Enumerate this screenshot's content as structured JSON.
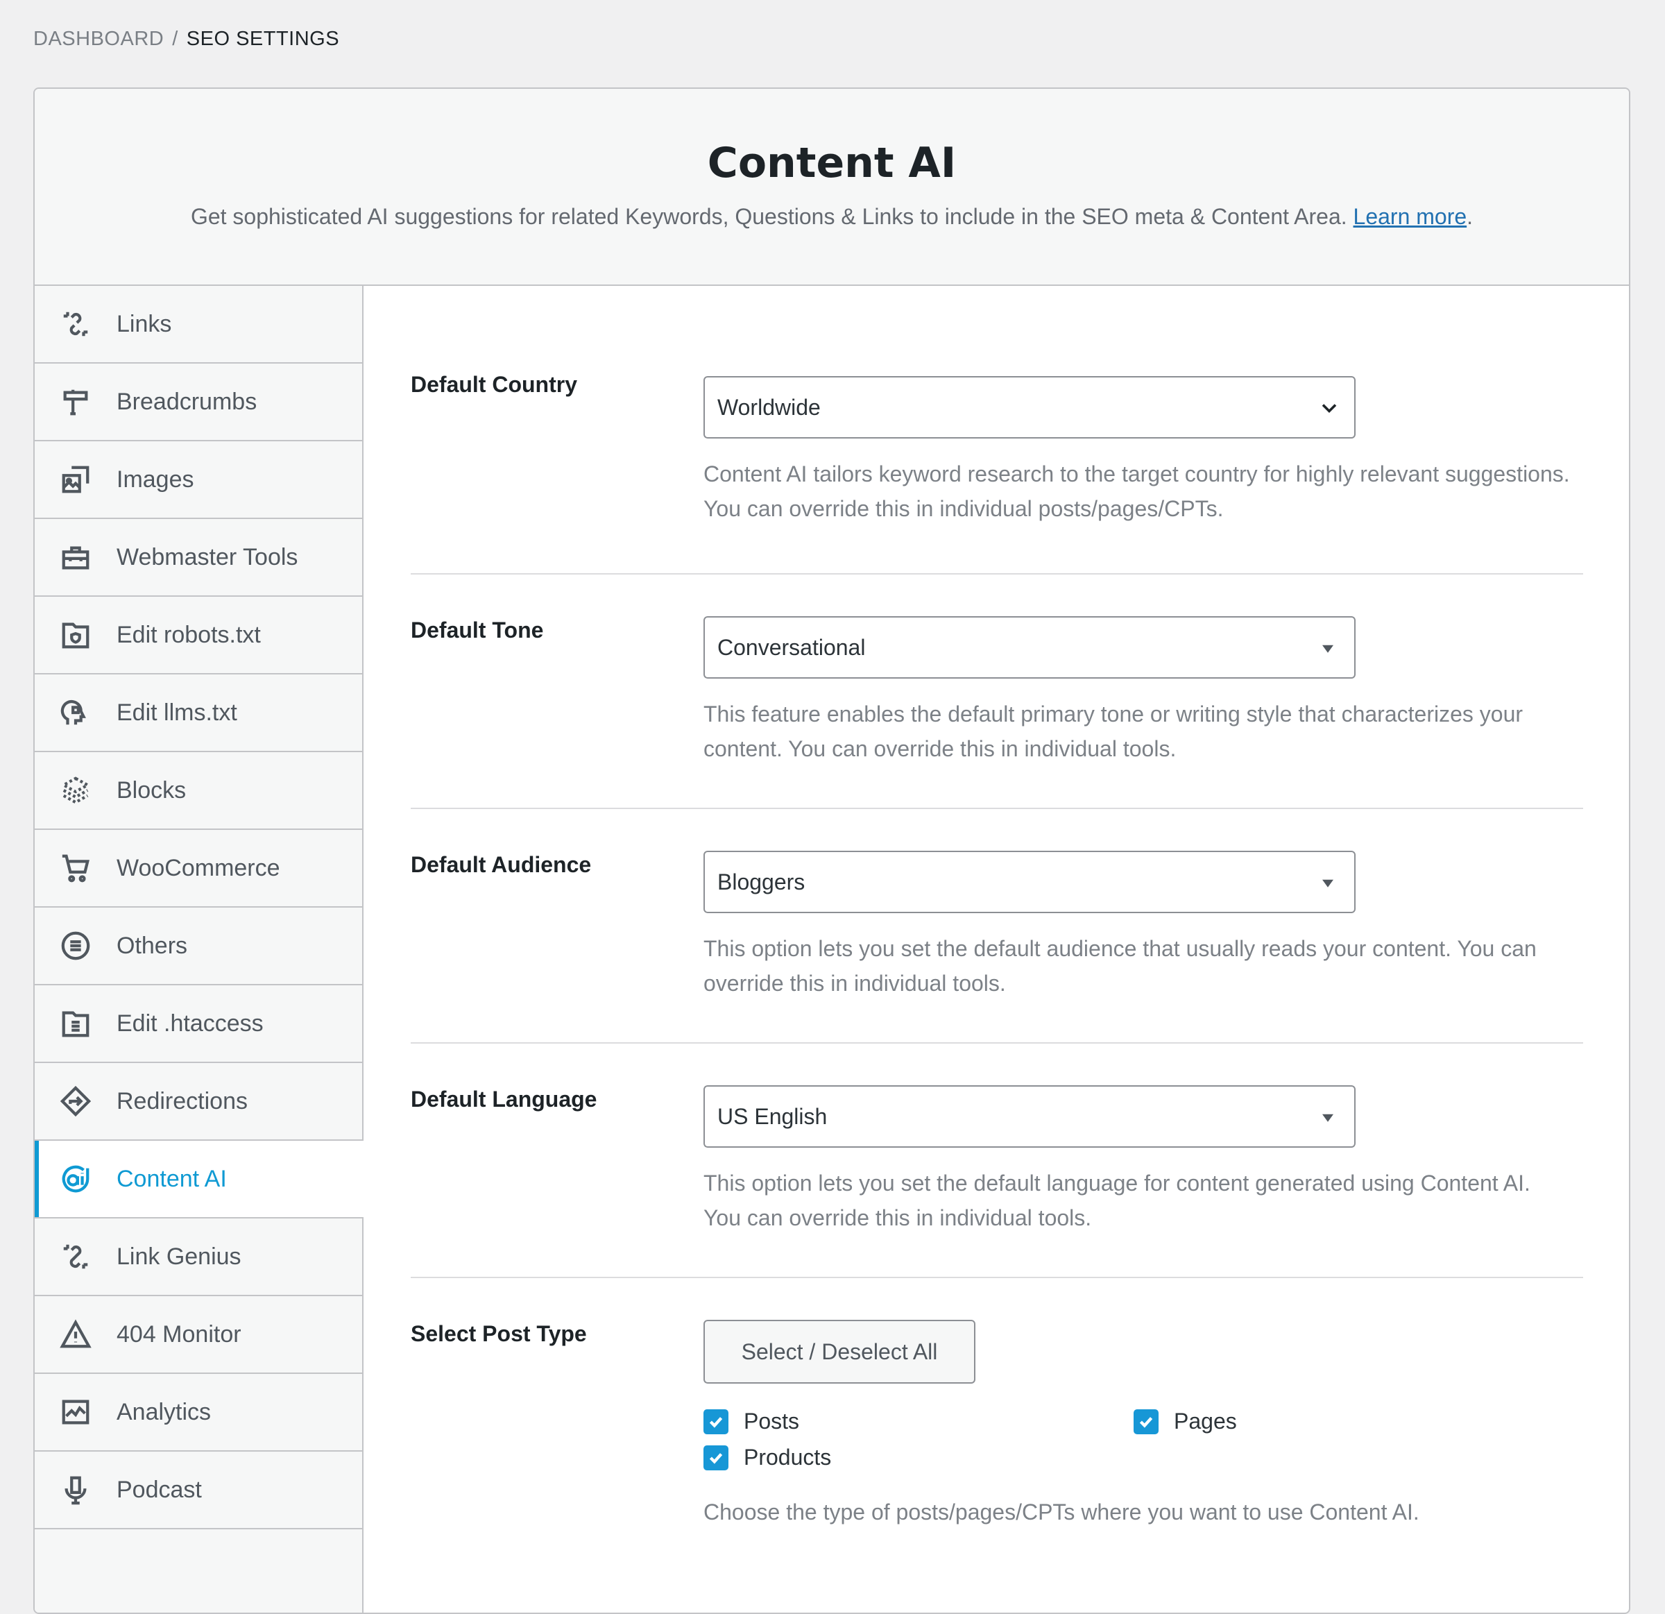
{
  "breadcrumb": {
    "parent": "DASHBOARD",
    "separator": "/",
    "current": "SEO SETTINGS"
  },
  "header": {
    "title": "Content AI",
    "description": "Get sophisticated AI suggestions for related Keywords, Questions & Links to include in the SEO meta & Content Area.",
    "learn_more": "Learn more",
    "trailing": "."
  },
  "sidebar": {
    "items": [
      {
        "label": "Links",
        "icon": "links-icon"
      },
      {
        "label": "Breadcrumbs",
        "icon": "signpost-icon"
      },
      {
        "label": "Images",
        "icon": "images-icon"
      },
      {
        "label": "Webmaster Tools",
        "icon": "toolbox-icon"
      },
      {
        "label": "Edit robots.txt",
        "icon": "robots-file-icon"
      },
      {
        "label": "Edit llms.txt",
        "icon": "ai-head-icon"
      },
      {
        "label": "Blocks",
        "icon": "blocks-icon"
      },
      {
        "label": "WooCommerce",
        "icon": "cart-icon"
      },
      {
        "label": "Others",
        "icon": "list-circle-icon"
      },
      {
        "label": "Edit .htaccess",
        "icon": "htaccess-file-icon"
      },
      {
        "label": "Redirections",
        "icon": "redirect-icon"
      },
      {
        "label": "Content AI",
        "icon": "content-ai-icon",
        "active": true
      },
      {
        "label": "Link Genius",
        "icon": "link-genius-icon"
      },
      {
        "label": "404 Monitor",
        "icon": "warning-icon"
      },
      {
        "label": "Analytics",
        "icon": "analytics-icon"
      },
      {
        "label": "Podcast",
        "icon": "microphone-icon"
      }
    ]
  },
  "settings": {
    "country": {
      "label": "Default Country",
      "value": "Worldwide",
      "description": "Content AI tailors keyword research to the target country for highly relevant suggestions. You can override this in individual posts/pages/CPTs."
    },
    "tone": {
      "label": "Default Tone",
      "value": "Conversational",
      "description": "This feature enables the default primary tone or writing style that characterizes your content. You can override this in individual tools."
    },
    "audience": {
      "label": "Default Audience",
      "value": "Bloggers",
      "description": "This option lets you set the default audience that usually reads your content. You can override this in individual tools."
    },
    "language": {
      "label": "Default Language",
      "value": "US English",
      "description": "This option lets you set the default language for content generated using Content AI. You can override this in individual tools."
    },
    "post_type": {
      "label": "Select Post Type",
      "button": "Select / Deselect All",
      "options": [
        {
          "label": "Posts",
          "checked": true
        },
        {
          "label": "Pages",
          "checked": true
        },
        {
          "label": "Products",
          "checked": true
        }
      ],
      "description": "Choose the type of posts/pages/CPTs where you want to use Content AI."
    }
  },
  "colors": {
    "accent": "#0f9ad3",
    "checkbox": "#1797d6",
    "link": "#2271b1"
  }
}
